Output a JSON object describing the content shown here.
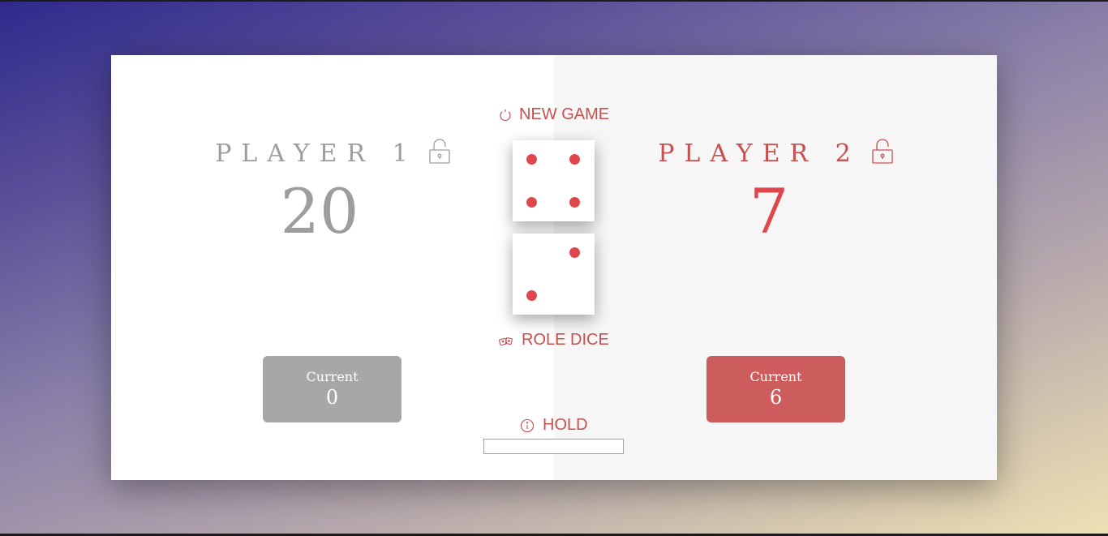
{
  "game": {
    "new_game_label": "NEW GAME",
    "roll_dice_label": "ROLE DICE",
    "hold_label": "HOLD",
    "target_score_value": "",
    "active_player": 2,
    "dice": [
      4,
      2
    ]
  },
  "players": [
    {
      "name": "PLAYER 1",
      "score": "20",
      "current_label": "Current",
      "current_value": "0",
      "color": "#9d9d9d"
    },
    {
      "name": "PLAYER 2",
      "score": "7",
      "current_label": "Current",
      "current_value": "6",
      "color": "#e0474c"
    }
  ],
  "colors": {
    "accent": "#c94f4f",
    "active_current_box": "#cd5c5c",
    "inactive_current_box": "#a7a7a7",
    "pip": "#e0474c"
  },
  "icons": {
    "new_game": "refresh-icon",
    "roll_dice": "dice-icon",
    "hold": "info-icon",
    "player_lock": "unlock-icon"
  }
}
